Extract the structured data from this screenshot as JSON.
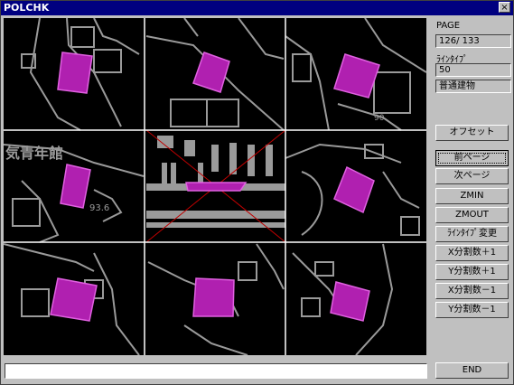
{
  "window": {
    "title": "POLCHK",
    "close_glyph": "×"
  },
  "side": {
    "page_label": "PAGE",
    "page_value": " 126/  133",
    "linetype_label": "ﾗｲﾝﾀｲﾌﾟ",
    "linetype_value": "50",
    "linetype_name": "普通建物"
  },
  "buttons": {
    "offset": "オフセット",
    "prev_page": "前ページ",
    "next_page": "次ページ",
    "zmin": "ZMIN",
    "zmout": "ZMOUT",
    "change_linetype": "ﾗｲﾝﾀｲﾌﾟ変更",
    "x_div_plus": "X分割数＋1",
    "y_div_plus": "Y分割数＋1",
    "x_div_minus": "X分割数－1",
    "y_div_minus": "Y分割数－1",
    "end": "END"
  },
  "map": {
    "columns": 3,
    "rows": 3,
    "background": "#000000",
    "grid_color": "#ffffff",
    "linework_color": "#9a9a9a",
    "polygon_color": "#d040d0",
    "cross_color": "#c00000",
    "labels": {
      "facility": "気青年館",
      "elevation": "93.6",
      "spot_value": "90"
    }
  },
  "status": {
    "text": ""
  }
}
